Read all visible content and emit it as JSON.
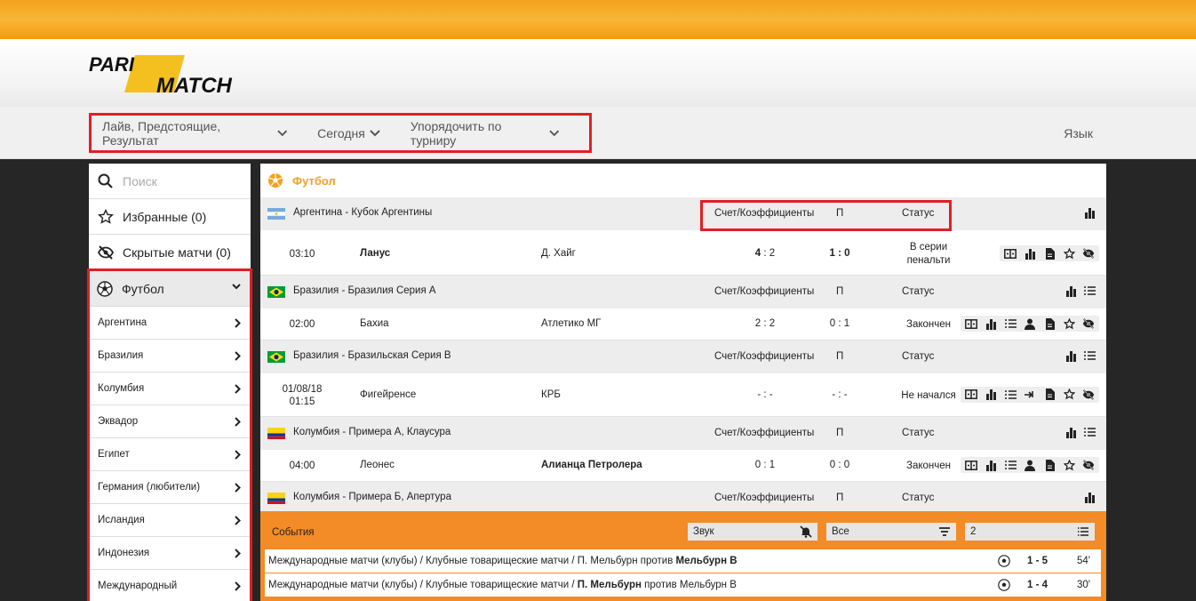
{
  "logo": {
    "line1": "PARI",
    "line2": "MATCH"
  },
  "filters": [
    {
      "label": "Лайв, Предстоящие, Результат"
    },
    {
      "label": "Сегодня"
    },
    {
      "label": "Упорядочить по турниру"
    }
  ],
  "language_label": "Язык",
  "sidebar": {
    "search_placeholder": "Поиск",
    "favorites": "Избранные (0)",
    "hidden": "Скрытые матчи (0)",
    "sport": "Футбол",
    "countries": [
      "Аргентина",
      "Бразилия",
      "Колумбия",
      "Эквадор",
      "Египет",
      "Германия (любители)",
      "Исландия",
      "Индонезия",
      "Международный"
    ]
  },
  "main": {
    "sport_title": "Футбол",
    "col_score": "Счет/Коэффициенты",
    "col_half": "П",
    "col_status": "Статус",
    "leagues": [
      {
        "name": "Аргентина - Кубок Аргентины",
        "flag": "argentina"
      },
      {
        "name": "Бразилия - Бразилия Серия А",
        "flag": "brazil"
      },
      {
        "name": "Бразилия - Бразильская Серия B",
        "flag": "brazil"
      },
      {
        "name": "Колумбия - Примера А, Клаусура",
        "flag": "colombia"
      },
      {
        "name": "Колумбия - Примера Б, Апертура",
        "flag": "colombia"
      }
    ],
    "matches": [
      {
        "time": "03:10",
        "date": "",
        "home": "Ланус",
        "away": "Д. Хайг",
        "score_a": "4",
        "score_b": "2",
        "half": "1 : 0",
        "status": "В серии",
        "status2": "пенальти"
      },
      {
        "time": "02:00",
        "date": "",
        "home": "Бахиа",
        "away": "Атлетико МГ",
        "score_a": "2",
        "score_b": "2",
        "half": "0 : 1",
        "status": "Закончен",
        "status2": ""
      },
      {
        "time": "01:15",
        "date": "01/08/18",
        "home": "Фигейренсе",
        "away": "КРБ",
        "score_a": "-",
        "score_b": "-",
        "half": "- : -",
        "status": "Не начался",
        "status2": ""
      },
      {
        "time": "04:00",
        "date": "",
        "home": "Леонес",
        "away": "Алианца Петролера",
        "score_a": "0",
        "score_b": "1",
        "half": "0 : 0",
        "status": "Закончен",
        "status2": ""
      }
    ]
  },
  "events": {
    "title": "События",
    "sound_label": "Звук",
    "filter_label": "Все",
    "count_label": "2",
    "rows": [
      {
        "prefix": "Международные матчи (клубы) / Клубные товарищеские матчи / П. Мельбурн против ",
        "bold": "Мельбурн В",
        "suffix": "",
        "score": "1 - 5",
        "minute": "54'"
      },
      {
        "prefix": "Международные матчи (клубы) / Клубные товарищеские матчи / ",
        "bold": "П. Мельбурн",
        "suffix": " против Мельбурн В",
        "score": "1 - 4",
        "minute": "30'"
      }
    ]
  }
}
